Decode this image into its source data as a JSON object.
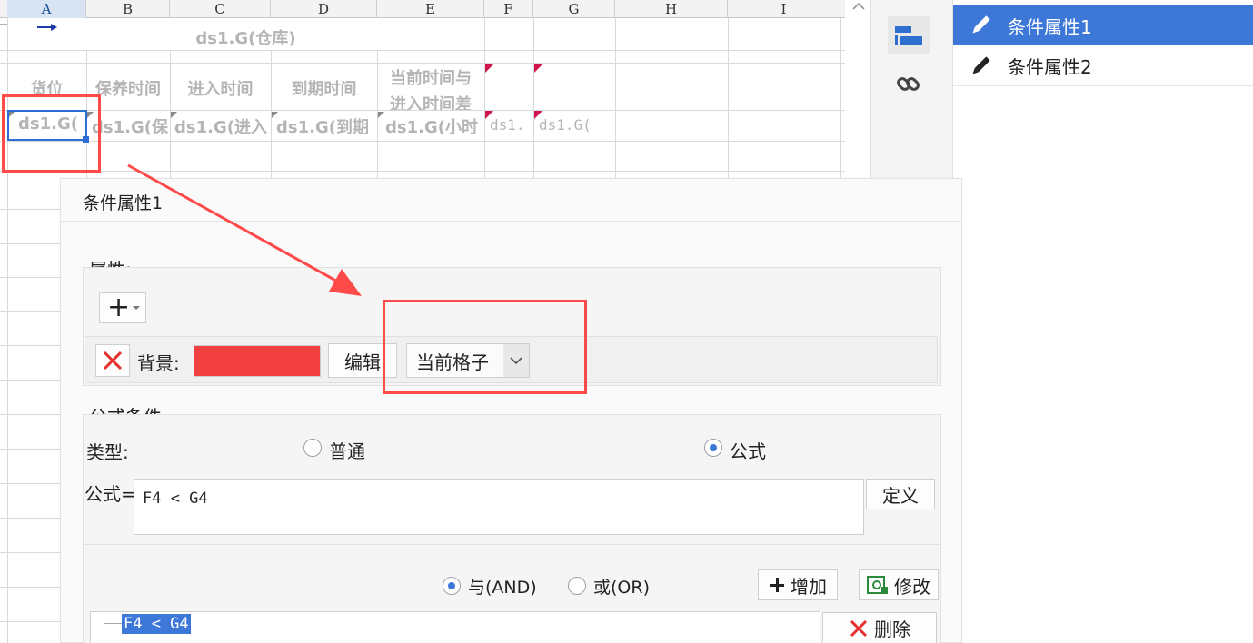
{
  "sheet": {
    "columns": [
      {
        "label": "A",
        "selected": true
      },
      {
        "label": "B"
      },
      {
        "label": "C"
      },
      {
        "label": "D"
      },
      {
        "label": "E"
      },
      {
        "label": "F"
      },
      {
        "label": "G"
      },
      {
        "label": "H"
      },
      {
        "label": "I"
      }
    ],
    "title_cell": "ds1.G(仓库)",
    "headers": {
      "a": "货位",
      "b": "保养时间",
      "c": "进入时间",
      "d": "到期时间",
      "e_line1": "当前时间与",
      "e_line2": "进入时间差"
    },
    "data_row": {
      "a": "ds1.G(",
      "b": "ds1.G(保",
      "c": "ds1.G(进入",
      "d": "ds1.G(到期",
      "e": "ds1.G(小时",
      "f": "ds1.",
      "g": "ds1.G("
    }
  },
  "toolbar": {
    "icons": [
      "cell-element-icon",
      "link-icon"
    ]
  },
  "condition_list": {
    "items": [
      {
        "label": "条件属性1",
        "active": true
      },
      {
        "label": "条件属性2",
        "active": false
      }
    ]
  },
  "dialog": {
    "title": "条件属性1",
    "property_label": "属性:",
    "add_symbol": "+",
    "background_label": "背景:",
    "background_color": "#f24040",
    "edit_button": "编辑",
    "scope_value": "当前格子",
    "formula_section_title": "公式条件",
    "type_label": "类型:",
    "type_options": [
      {
        "label": "普通",
        "selected": false
      },
      {
        "label": "公式",
        "selected": true
      }
    ],
    "formula_label": "公式=",
    "formula_value": "F4 < G4",
    "define_button": "定义",
    "logic_options": [
      {
        "label": "与(AND)",
        "selected": true
      },
      {
        "label": "或(OR)",
        "selected": false
      }
    ],
    "add_button": "增加",
    "modify_button": "修改",
    "delete_button": "删除",
    "condition_rows": [
      "F4 < G4"
    ]
  },
  "colors": {
    "accent": "#3d78d8",
    "annotation": "#ff4a4a",
    "marker": "#d0154d"
  }
}
